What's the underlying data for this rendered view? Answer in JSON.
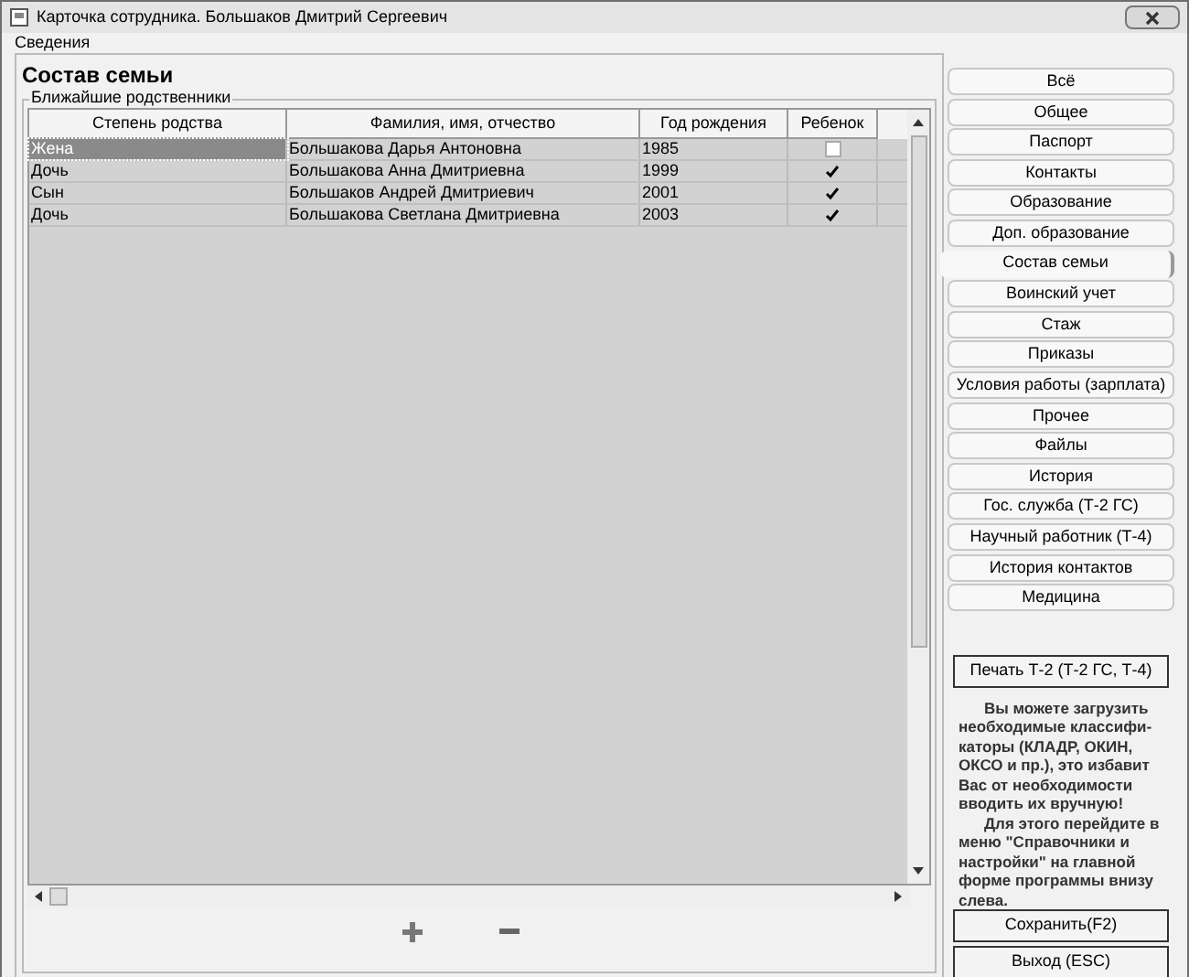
{
  "window": {
    "title": "Карточка сотрудника. Большаков Дмитрий Сергеевич"
  },
  "group": {
    "label": "Сведения"
  },
  "section": {
    "title": "Состав семьи",
    "subgroup": "Ближайшие родственники"
  },
  "table": {
    "columns": [
      "Степень родства",
      "Фамилия, имя, отчество",
      "Год рождения",
      "Ребенок"
    ],
    "rows": [
      {
        "cells": [
          "Жена",
          "Большакова Дарья Антоновна",
          "1985"
        ],
        "checked": false,
        "selected": true
      },
      {
        "cells": [
          "Дочь",
          "Большакова Анна Дмитриевна",
          "1999"
        ],
        "checked": true,
        "selected": false
      },
      {
        "cells": [
          "Сын",
          "Большаков Андрей Дмитриевич",
          "2001"
        ],
        "checked": true,
        "selected": false
      },
      {
        "cells": [
          "Дочь",
          "Большакова Светлана Дмитриевна",
          "2003"
        ],
        "checked": true,
        "selected": false
      }
    ]
  },
  "nav": [
    {
      "label": "Всё",
      "selected": false
    },
    {
      "label": "Общее",
      "selected": false
    },
    {
      "label": "Паспорт",
      "selected": false
    },
    {
      "label": "Контакты",
      "selected": false
    },
    {
      "label": "Образование",
      "selected": false
    },
    {
      "label": "Доп. образование",
      "selected": false
    },
    {
      "label": "Состав семьи",
      "selected": true
    },
    {
      "label": "Воинский учет",
      "selected": false
    },
    {
      "label": "Стаж",
      "selected": false
    },
    {
      "label": "Приказы",
      "selected": false
    },
    {
      "label": "Условия работы (зарплата)",
      "selected": false
    },
    {
      "label": "Прочее",
      "selected": false
    },
    {
      "label": "Файлы",
      "selected": false
    },
    {
      "label": "История",
      "selected": false
    },
    {
      "label": "Гос. служба (Т-2 ГС)",
      "selected": false
    },
    {
      "label": "Научный работник (Т-4)",
      "selected": false
    },
    {
      "label": "История контактов",
      "selected": false
    },
    {
      "label": "Медицина",
      "selected": false
    }
  ],
  "print_button": "Печать Т-2 (Т-2 ГС, Т-4)",
  "hint": [
    "Вы можете загрузить необходимые классифи-каторы (КЛАДР, ОКИН, ОКСО и пр.), это избавит Вас от необходимости вводить их вручную!",
    "Для этого перейдите в меню \"Справочники и настройки\" на главной форме программы внизу слева."
  ],
  "buttons": [
    "Сохранить(F2)",
    "Выход (ESC)"
  ]
}
